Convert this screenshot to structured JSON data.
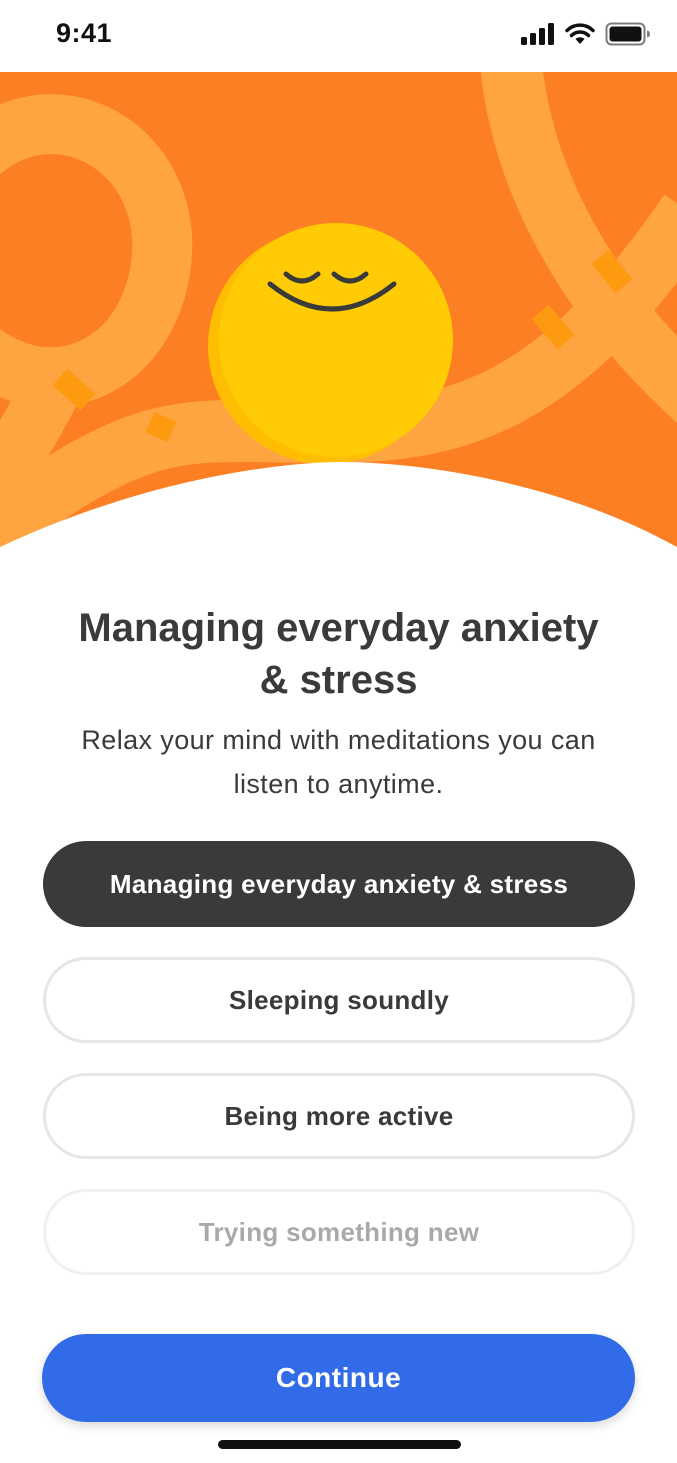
{
  "status_bar": {
    "time": "9:41",
    "icons": [
      "cellular-signal-icon",
      "wifi-icon",
      "battery-icon"
    ]
  },
  "hero": {
    "illustration": "smiling-sun-illustration",
    "colors": {
      "background": "#fd7f23",
      "ribbon": "#fea440",
      "ribbon_overlap": "#fe9a10",
      "sun": "#ffcb05",
      "sun_shadow": "#ffbe02",
      "face": "#3a3a3a"
    }
  },
  "title": "Managing everyday anxiety & stress",
  "subtitle": "Relax your mind with meditations you can listen to anytime.",
  "options": [
    {
      "label": "Managing everyday anxiety & stress",
      "selected": true
    },
    {
      "label": "Sleeping soundly",
      "selected": false
    },
    {
      "label": "Being more active",
      "selected": false
    },
    {
      "label": "Trying something new",
      "selected": false
    }
  ],
  "continue_label": "Continue",
  "colors": {
    "accent": "#326be8",
    "selected_option": "#3a3a3a",
    "text": "#3a3a3a",
    "option_border": "#e6e6e6"
  }
}
